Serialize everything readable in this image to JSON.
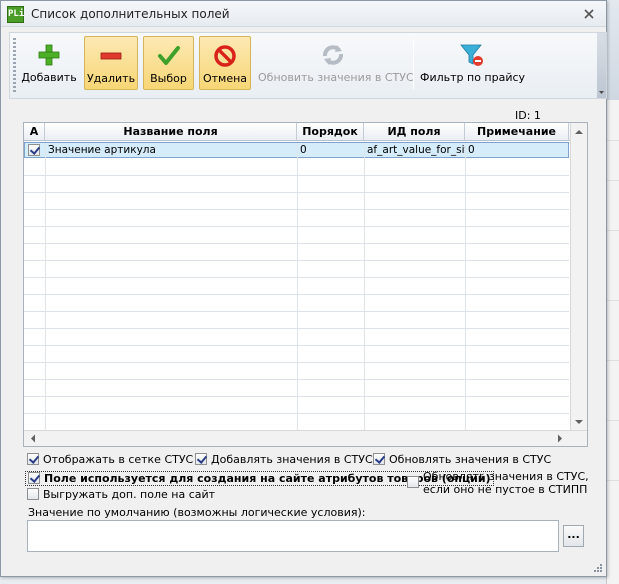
{
  "window": {
    "title": "Список дополнительных полей",
    "app_icon_text": "PLi"
  },
  "toolbar": {
    "add": "Добавить",
    "delete": "Удалить",
    "select": "Выбор",
    "cancel": "Отмена",
    "update_values": "Обновить значения в СТУС",
    "filter": "Фильтр по прайсу"
  },
  "record_id": "ID: 1",
  "grid": {
    "columns": [
      "A",
      "Название поля",
      "Порядок",
      "ИД поля",
      "Примечание"
    ],
    "rows": [
      {
        "checked": true,
        "name": "Значение артикула",
        "order": "0",
        "field_id": "af_art_value_for_sit",
        "note": "0"
      }
    ]
  },
  "options": {
    "show_in_grid": "Отображать в сетке СТУС",
    "add_values": "Добавлять значения в СТУС",
    "update_values": "Обновлять значения в СТУС",
    "used_for_attributes": "Поле используется для создания на сайте атрибутов товаров (опций)",
    "update_if_not_empty_line1": "Обновлять значения в СТУС,",
    "update_if_not_empty_line2": "если оно не пустое в СТИПП",
    "export_to_site": "Выгружать доп. поле на сайт"
  },
  "default_value": {
    "label": "Значение по умолчанию (возможны логические условия):",
    "value": "",
    "button": "..."
  },
  "colors": {
    "selected_row": "#d5ecfa",
    "pressed_button": "#f7d675"
  }
}
